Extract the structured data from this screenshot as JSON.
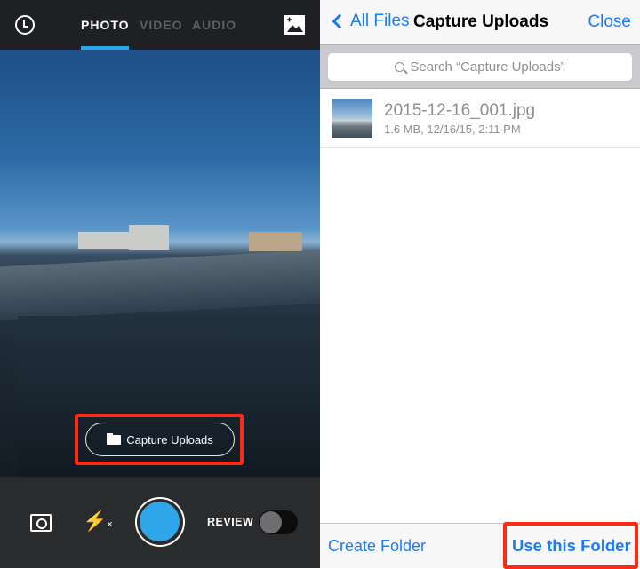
{
  "camera": {
    "modes": [
      "PHOTO",
      "VIDEO",
      "AUDIO"
    ],
    "active_mode": "PHOTO",
    "folder_button": "Capture Uploads",
    "review_label": "REVIEW",
    "review_on": false,
    "accent": "#2ca4e8",
    "flash_x": "×"
  },
  "browser": {
    "back_label": "All Files",
    "title": "Capture Uploads",
    "close_label": "Close",
    "search_placeholder": "Search “Capture Uploads”",
    "files": [
      {
        "name": "2015-12-16_001.jpg",
        "meta": "1.6 MB, 12/16/15, 2:11 PM"
      }
    ],
    "create_folder": "Create Folder",
    "use_folder": "Use this Folder",
    "link_color": "#1c7cf4",
    "highlight_color": "#ff2a14"
  }
}
